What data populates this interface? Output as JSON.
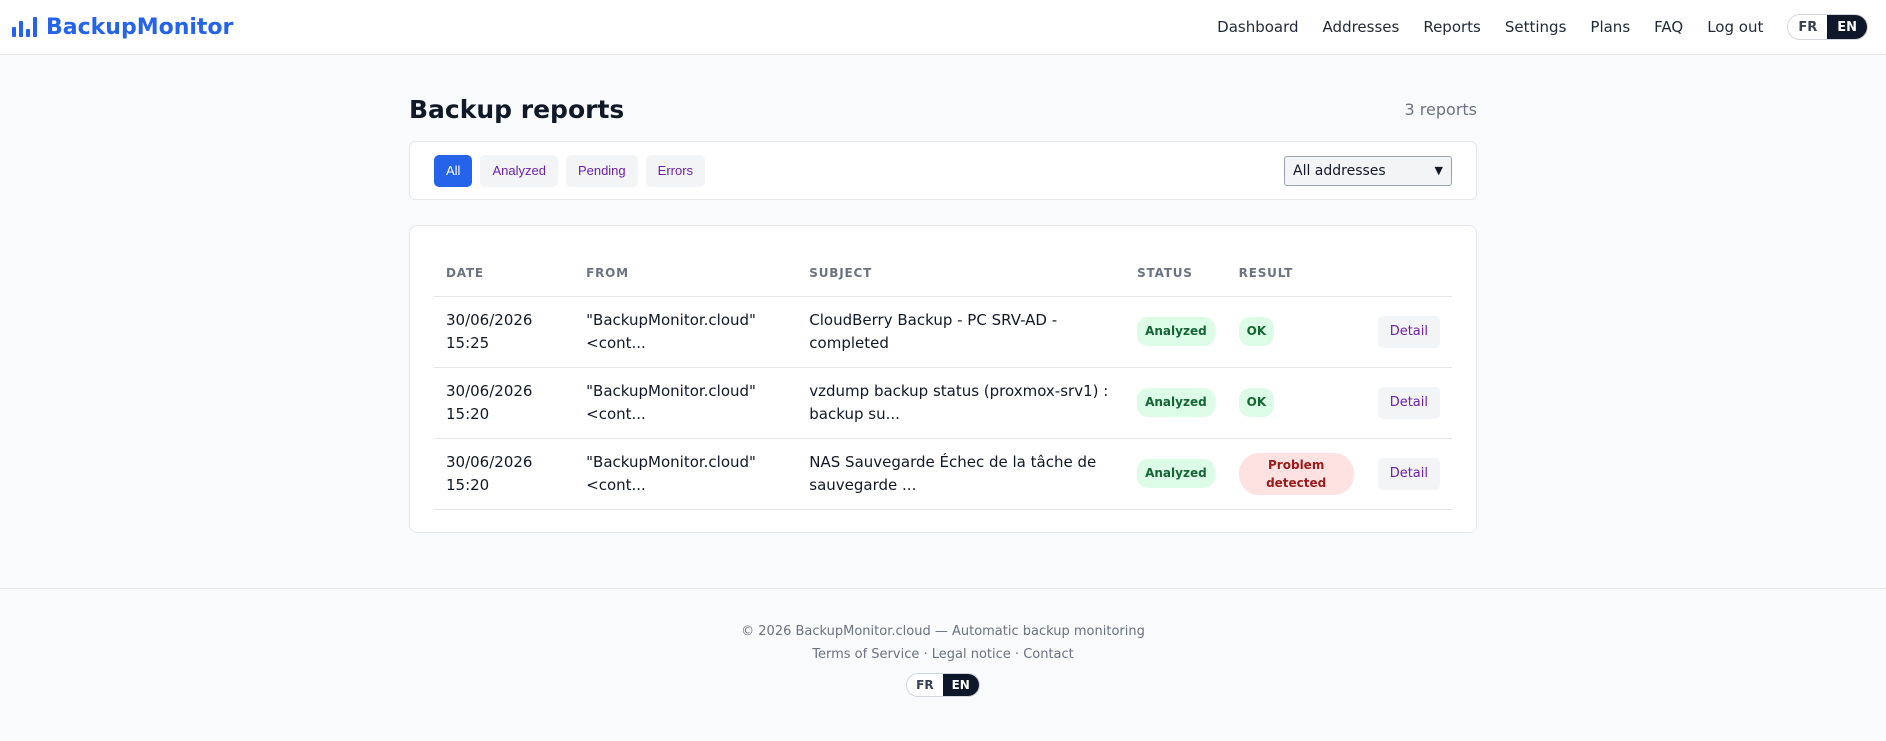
{
  "brand": {
    "name": "BackupMonitor"
  },
  "nav": {
    "items": [
      "Dashboard",
      "Addresses",
      "Reports",
      "Settings",
      "Plans",
      "FAQ",
      "Log out"
    ],
    "lang": [
      "FR",
      "EN"
    ],
    "active_lang": "EN"
  },
  "page": {
    "title": "Backup reports",
    "count": "3 reports"
  },
  "filters": {
    "buttons": [
      "All",
      "Analyzed",
      "Pending",
      "Errors"
    ],
    "active": "All",
    "address_select": "All addresses"
  },
  "table": {
    "headers": [
      "DATE",
      "FROM",
      "SUBJECT",
      "STATUS",
      "RESULT"
    ],
    "rows": [
      {
        "date": "30/06/2026 15:25",
        "from_1": "\"BackupMonitor.cloud\"",
        "from_2": "<cont...",
        "subject_1": "CloudBerry Backup - PC SRV-AD - completed",
        "subject_2": "",
        "status": "Analyzed",
        "result": "OK",
        "action": "Detail"
      },
      {
        "date": "30/06/2026 15:20",
        "from_1": "\"BackupMonitor.cloud\"",
        "from_2": "<cont...",
        "subject_1": "vzdump backup status (proxmox-srv1) :",
        "subject_2": "backup su...",
        "status": "Analyzed",
        "result": "OK",
        "action": "Detail"
      },
      {
        "date": "30/06/2026 15:20",
        "from_1": "\"BackupMonitor.cloud\"",
        "from_2": "<cont...",
        "subject_1": "NAS Sauvegarde Échec de la tâche de",
        "subject_2": "sauvegarde ...",
        "status": "Analyzed",
        "result": "Problem detected",
        "action": "Detail"
      }
    ]
  },
  "footer": {
    "copyright": "© 2026 BackupMonitor.cloud — Automatic backup monitoring",
    "links": [
      "Terms of Service",
      "Legal notice",
      "Contact"
    ],
    "separator": " · ",
    "lang": [
      "FR",
      "EN"
    ]
  },
  "colors": {
    "accent": "#2563eb",
    "success_bg": "#dcfce7",
    "success_fg": "#166534",
    "danger_bg": "#fee2e2",
    "danger_fg": "#991b1b"
  }
}
